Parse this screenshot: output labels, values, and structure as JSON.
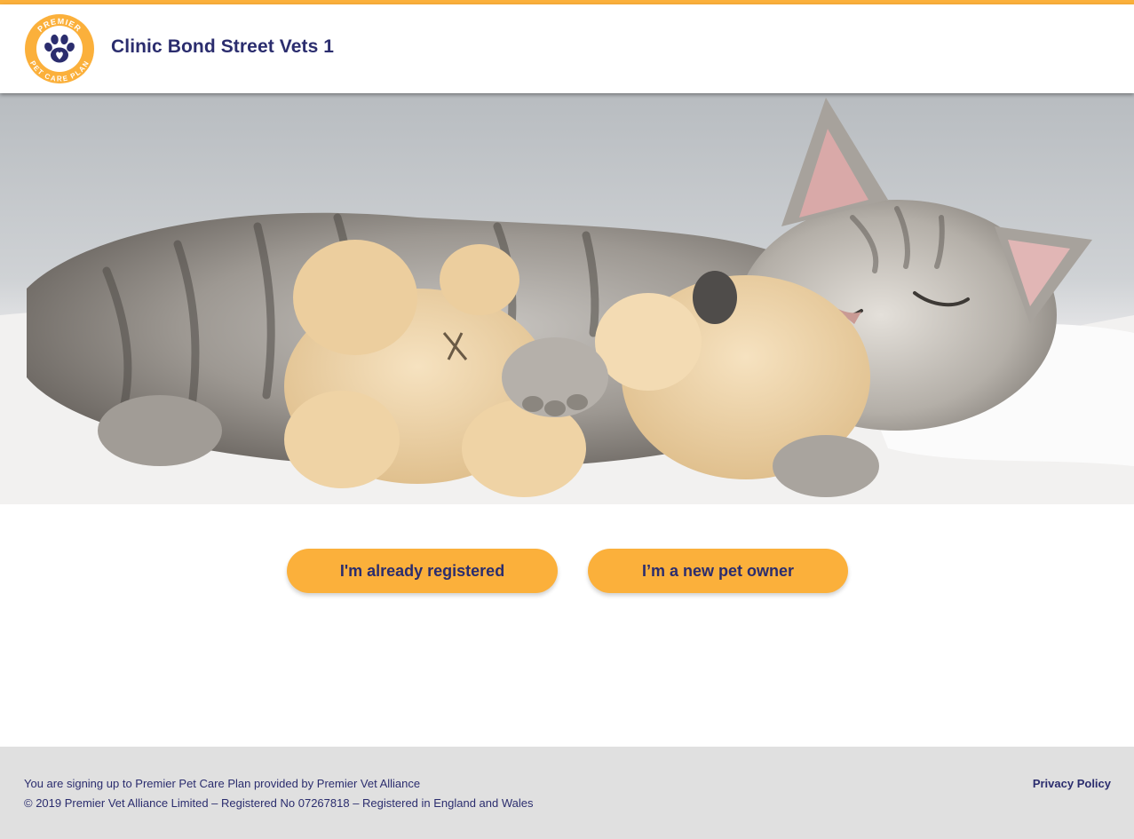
{
  "header": {
    "clinic_title": "Clinic Bond Street Vets 1",
    "logo_text_top": "PREMIER",
    "logo_text_bottom": "PET CARE PLAN"
  },
  "hero": {
    "image_alt": "hero-photo"
  },
  "actions": {
    "registered_label": "I'm already registered",
    "new_owner_label": "I’m a new pet owner"
  },
  "footer": {
    "line1": "You are signing up to Premier Pet Care Plan provided by Premier Vet Alliance",
    "line2": "© 2019 Premier Vet Alliance Limited – Registered No 07267818 – Registered in England and Wales",
    "privacy_label": "Privacy Policy"
  },
  "colors": {
    "accent": "#fbb03b",
    "brand_text": "#2b2d6e",
    "footer_bg": "#e0e0e0"
  },
  "icons": [
    "paw-icon"
  ]
}
